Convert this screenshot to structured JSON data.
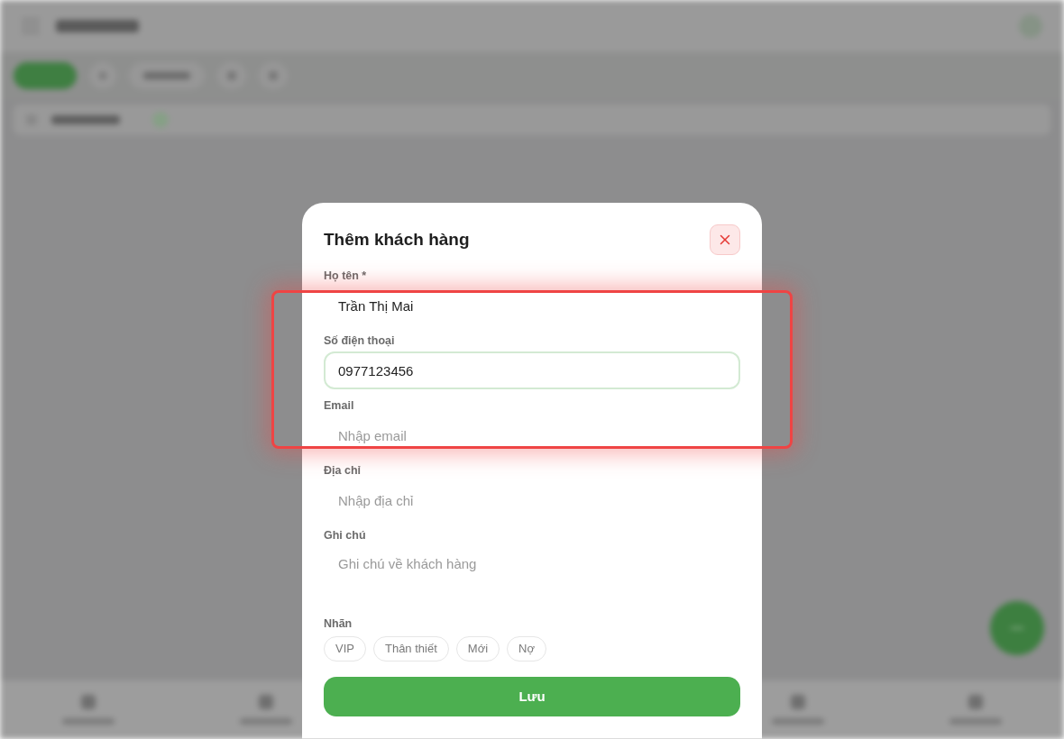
{
  "modal": {
    "title": "Thêm khách hàng",
    "fields": [
      {
        "kind": "input",
        "label": "Họ tên *",
        "value": "Trần Thị Mai",
        "focused": false
      },
      {
        "kind": "input",
        "label": "Số điện thoại",
        "value": "0977123456",
        "focused": true
      },
      {
        "kind": "input",
        "label": "Email",
        "placeholder": "Nhập email",
        "focused": false
      },
      {
        "kind": "input",
        "label": "Địa chỉ",
        "placeholder": "Nhập địa chỉ",
        "focused": false
      },
      {
        "kind": "textarea",
        "label": "Ghi chú",
        "placeholder": "Ghi chú về khách hàng",
        "focused": false
      }
    ],
    "tags": {
      "label": "Nhãn",
      "options": [
        {
          "label": "VIP",
          "selected": false
        },
        {
          "label": "Thân thiết",
          "selected": false
        },
        {
          "label": "Mới",
          "selected": false
        },
        {
          "label": "Nợ",
          "selected": false
        }
      ]
    },
    "save_button": "Lưu"
  }
}
